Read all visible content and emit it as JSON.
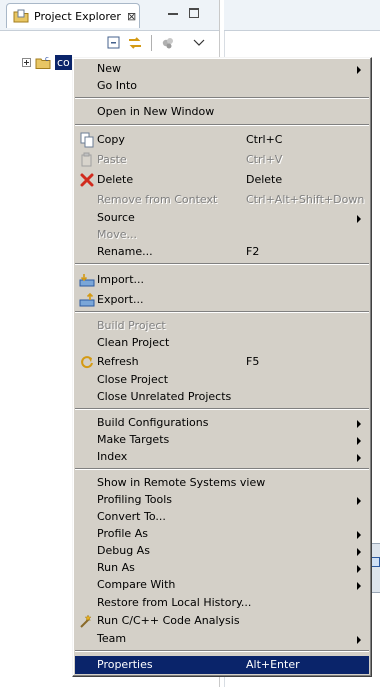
{
  "view": {
    "tab_title": "Project Explorer",
    "tab_close": "⊠",
    "tree_item_label": "co"
  },
  "menu": {
    "new": {
      "label": "New"
    },
    "go_into": {
      "label": "Go Into"
    },
    "open_in_new_window": {
      "label": "Open in New Window"
    },
    "copy": {
      "label": "Copy",
      "accel": "Ctrl+C"
    },
    "paste": {
      "label": "Paste",
      "accel": "Ctrl+V"
    },
    "delete": {
      "label": "Delete",
      "accel": "Delete"
    },
    "remove_from_context": {
      "label": "Remove from Context",
      "accel": "Ctrl+Alt+Shift+Down"
    },
    "source": {
      "label": "Source"
    },
    "move": {
      "label": "Move..."
    },
    "rename": {
      "label": "Rename...",
      "accel": "F2"
    },
    "import": {
      "label": "Import..."
    },
    "export": {
      "label": "Export..."
    },
    "build_project": {
      "label": "Build Project"
    },
    "clean_project": {
      "label": "Clean Project"
    },
    "refresh": {
      "label": "Refresh",
      "accel": "F5"
    },
    "close_project": {
      "label": "Close Project"
    },
    "close_unrelated": {
      "label": "Close Unrelated Projects"
    },
    "build_configurations": {
      "label": "Build Configurations"
    },
    "make_targets": {
      "label": "Make Targets"
    },
    "index": {
      "label": "Index"
    },
    "show_remote": {
      "label": "Show in Remote Systems view"
    },
    "profiling_tools": {
      "label": "Profiling Tools"
    },
    "convert_to": {
      "label": "Convert To..."
    },
    "profile_as": {
      "label": "Profile As"
    },
    "debug_as": {
      "label": "Debug As"
    },
    "run_as": {
      "label": "Run As"
    },
    "compare_with": {
      "label": "Compare With"
    },
    "restore_history": {
      "label": "Restore from Local History..."
    },
    "run_code_analysis": {
      "label": "Run C/C++ Code Analysis"
    },
    "team": {
      "label": "Team"
    },
    "properties": {
      "label": "Properties",
      "accel": "Alt+Enter"
    }
  },
  "colors": {
    "menu_bg": "#d4d0c8",
    "selection": "#0a246a",
    "disabled_text": "#808080"
  },
  "icons": {
    "view_tab": "project-explorer-icon",
    "collapse_all": "collapse-all-icon",
    "link_editor": "link-with-editor-icon",
    "view_menu": "view-menu-icon",
    "project": "c-project-folder-icon",
    "copy": "copy-icon",
    "paste": "paste-icon",
    "delete": "delete-x-icon",
    "import": "import-icon",
    "export": "export-icon",
    "refresh": "refresh-icon",
    "code_analysis": "code-analysis-icon"
  }
}
